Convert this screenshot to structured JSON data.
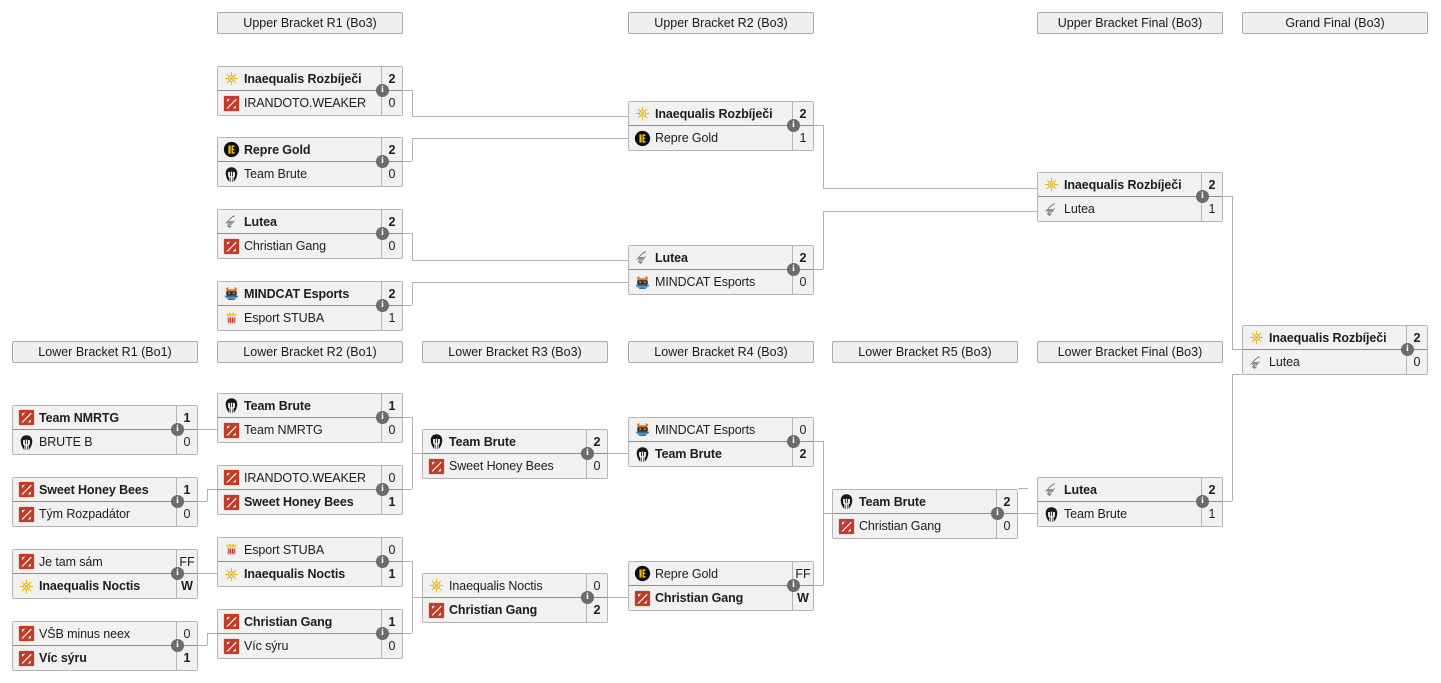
{
  "rounds": [
    {
      "id": "ub-r1",
      "label": "Upper Bracket R1 (Bo3)"
    },
    {
      "id": "ub-r2",
      "label": "Upper Bracket R2 (Bo3)"
    },
    {
      "id": "ub-f",
      "label": "Upper Bracket Final (Bo3)"
    },
    {
      "id": "gf",
      "label": "Grand Final (Bo3)"
    },
    {
      "id": "lb-r1",
      "label": "Lower Bracket R1 (Bo1)"
    },
    {
      "id": "lb-r2",
      "label": "Lower Bracket R2 (Bo1)"
    },
    {
      "id": "lb-r3",
      "label": "Lower Bracket R3 (Bo3)"
    },
    {
      "id": "lb-r4",
      "label": "Lower Bracket R4 (Bo3)"
    },
    {
      "id": "lb-r5",
      "label": "Lower Bracket R5 (Bo3)"
    },
    {
      "id": "lb-f",
      "label": "Lower Bracket Final (Bo3)"
    }
  ],
  "info_label": "i",
  "matches": [
    {
      "id": "ub-r1-m1",
      "round": "ub-r1",
      "top": {
        "team": "Inaequalis Rozbíječi",
        "logo": "inaequalis",
        "score": "2",
        "winner": true
      },
      "bottom": {
        "team": "IRANDOTO.WEAKER",
        "logo": "dota",
        "score": "0",
        "winner": false
      }
    },
    {
      "id": "ub-r1-m2",
      "round": "ub-r1",
      "top": {
        "team": "Repre Gold",
        "logo": "repregold",
        "score": "2",
        "winner": true
      },
      "bottom": {
        "team": "Team Brute",
        "logo": "brute",
        "score": "0",
        "winner": false
      }
    },
    {
      "id": "ub-r1-m3",
      "round": "ub-r1",
      "top": {
        "team": "Lutea",
        "logo": "lutea",
        "score": "2",
        "winner": true
      },
      "bottom": {
        "team": "Christian Gang",
        "logo": "dota",
        "score": "0",
        "winner": false
      }
    },
    {
      "id": "ub-r1-m4",
      "round": "ub-r1",
      "top": {
        "team": "MINDCAT Esports",
        "logo": "mindcat",
        "score": "2",
        "winner": true
      },
      "bottom": {
        "team": "Esport STUBA",
        "logo": "stuba",
        "score": "1",
        "winner": false
      }
    },
    {
      "id": "ub-r2-m1",
      "round": "ub-r2",
      "top": {
        "team": "Inaequalis Rozbíječi",
        "logo": "inaequalis",
        "score": "2",
        "winner": true
      },
      "bottom": {
        "team": "Repre Gold",
        "logo": "repregold",
        "score": "1",
        "winner": false
      }
    },
    {
      "id": "ub-r2-m2",
      "round": "ub-r2",
      "top": {
        "team": "Lutea",
        "logo": "lutea",
        "score": "2",
        "winner": true
      },
      "bottom": {
        "team": "MINDCAT Esports",
        "logo": "mindcat",
        "score": "0",
        "winner": false
      }
    },
    {
      "id": "ub-f-m1",
      "round": "ub-f",
      "top": {
        "team": "Inaequalis Rozbíječi",
        "logo": "inaequalis",
        "score": "2",
        "winner": true
      },
      "bottom": {
        "team": "Lutea",
        "logo": "lutea",
        "score": "1",
        "winner": false
      }
    },
    {
      "id": "gf-m1",
      "round": "gf",
      "top": {
        "team": "Inaequalis Rozbíječi",
        "logo": "inaequalis",
        "score": "2",
        "winner": true
      },
      "bottom": {
        "team": "Lutea",
        "logo": "lutea",
        "score": "0",
        "winner": false
      }
    },
    {
      "id": "lb-r1-m1",
      "round": "lb-r1",
      "top": {
        "team": "Team NMRTG",
        "logo": "dota",
        "score": "1",
        "winner": true
      },
      "bottom": {
        "team": "BRUTE B",
        "logo": "brute",
        "score": "0",
        "winner": false
      }
    },
    {
      "id": "lb-r1-m2",
      "round": "lb-r1",
      "top": {
        "team": "Sweet Honey Bees",
        "logo": "dota",
        "score": "1",
        "winner": true
      },
      "bottom": {
        "team": "Tým Rozpadátor",
        "logo": "dota",
        "score": "0",
        "winner": false
      }
    },
    {
      "id": "lb-r1-m3",
      "round": "lb-r1",
      "top": {
        "team": "Je tam sám",
        "logo": "dota",
        "score": "FF",
        "winner": false
      },
      "bottom": {
        "team": "Inaequalis Noctis",
        "logo": "inaequalis",
        "score": "W",
        "winner": true
      }
    },
    {
      "id": "lb-r1-m4",
      "round": "lb-r1",
      "top": {
        "team": "VŠB minus neex",
        "logo": "dota",
        "score": "0",
        "winner": false
      },
      "bottom": {
        "team": "Víc sýru",
        "logo": "dota",
        "score": "1",
        "winner": true
      }
    },
    {
      "id": "lb-r2-m1",
      "round": "lb-r2",
      "top": {
        "team": "Team Brute",
        "logo": "brute",
        "score": "1",
        "winner": true
      },
      "bottom": {
        "team": "Team NMRTG",
        "logo": "dota",
        "score": "0",
        "winner": false
      }
    },
    {
      "id": "lb-r2-m2",
      "round": "lb-r2",
      "top": {
        "team": "IRANDOTO.WEAKER",
        "logo": "dota",
        "score": "0",
        "winner": false
      },
      "bottom": {
        "team": "Sweet Honey Bees",
        "logo": "dota",
        "score": "1",
        "winner": true
      }
    },
    {
      "id": "lb-r2-m3",
      "round": "lb-r2",
      "top": {
        "team": "Esport STUBA",
        "logo": "stuba",
        "score": "0",
        "winner": false
      },
      "bottom": {
        "team": "Inaequalis Noctis",
        "logo": "inaequalis",
        "score": "1",
        "winner": true
      }
    },
    {
      "id": "lb-r2-m4",
      "round": "lb-r2",
      "top": {
        "team": "Christian Gang",
        "logo": "dota",
        "score": "1",
        "winner": true
      },
      "bottom": {
        "team": "Víc sýru",
        "logo": "dota",
        "score": "0",
        "winner": false
      }
    },
    {
      "id": "lb-r3-m1",
      "round": "lb-r3",
      "top": {
        "team": "Team Brute",
        "logo": "brute",
        "score": "2",
        "winner": true
      },
      "bottom": {
        "team": "Sweet Honey Bees",
        "logo": "dota",
        "score": "0",
        "winner": false
      }
    },
    {
      "id": "lb-r3-m2",
      "round": "lb-r3",
      "top": {
        "team": "Inaequalis Noctis",
        "logo": "inaequalis",
        "score": "0",
        "winner": false
      },
      "bottom": {
        "team": "Christian Gang",
        "logo": "dota",
        "score": "2",
        "winner": true
      }
    },
    {
      "id": "lb-r4-m1",
      "round": "lb-r4",
      "top": {
        "team": "MINDCAT Esports",
        "logo": "mindcat",
        "score": "0",
        "winner": false
      },
      "bottom": {
        "team": "Team Brute",
        "logo": "brute",
        "score": "2",
        "winner": true
      }
    },
    {
      "id": "lb-r4-m2",
      "round": "lb-r4",
      "top": {
        "team": "Repre Gold",
        "logo": "repregold",
        "score": "FF",
        "winner": false
      },
      "bottom": {
        "team": "Christian Gang",
        "logo": "dota",
        "score": "W",
        "winner": true
      }
    },
    {
      "id": "lb-r5-m1",
      "round": "lb-r5",
      "top": {
        "team": "Team Brute",
        "logo": "brute",
        "score": "2",
        "winner": true
      },
      "bottom": {
        "team": "Christian Gang",
        "logo": "dota",
        "score": "0",
        "winner": false
      }
    },
    {
      "id": "lb-f-m1",
      "round": "lb-f",
      "top": {
        "team": "Lutea",
        "logo": "lutea",
        "score": "2",
        "winner": true
      },
      "bottom": {
        "team": "Team Brute",
        "logo": "brute",
        "score": "1",
        "winner": false
      }
    }
  ],
  "colors": {
    "box_bg": "#f1f1f1",
    "box_border": "#b4b4b4",
    "header_bg": "#efefef",
    "header_border": "#aaaaaa",
    "connector": "#b0b0b0",
    "info_badge": "#6b6b6b",
    "dota_red": "#c23c2a",
    "gold": "#f2c200"
  }
}
